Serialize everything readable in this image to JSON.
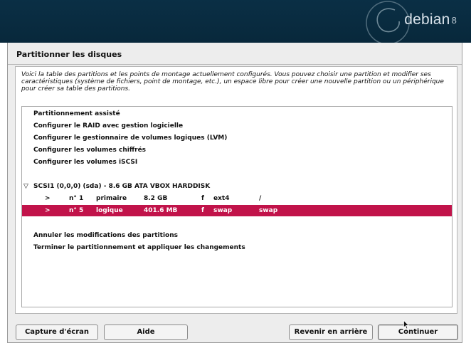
{
  "banner": {
    "brand": "debian",
    "version": "8"
  },
  "page": {
    "title": "Partitionner les disques",
    "intro": "Voici la table des partitions et les points de montage actuellement configurés. Vous pouvez choisir une partition et modifier ses caractéristiques (système de fichiers, point de montage, etc.), un espace libre pour créer une nouvelle partition ou un périphérique pour créer sa table des partitions."
  },
  "menu": {
    "items": [
      "Partitionnement assisté",
      "Configurer le RAID avec gestion logicielle",
      "Configurer le gestionnaire de volumes logiques (LVM)",
      "Configurer les volumes chiffrés",
      "Configurer les volumes iSCSI"
    ],
    "disk": {
      "toggle": "▽",
      "label": "SCSI1 (0,0,0) (sda) - 8.6 GB ATA VBOX HARDDISK"
    },
    "partitions": [
      {
        "arrow": ">",
        "num": "n° 1",
        "type": "primaire",
        "size": "8.2 GB",
        "flag": "f",
        "fs": "ext4",
        "mount": "/"
      },
      {
        "arrow": ">",
        "num": "n° 5",
        "type": "logique",
        "size": "401.6 MB",
        "flag": "f",
        "fs": "swap",
        "mount": "swap"
      }
    ],
    "actions": [
      "Annuler les modifications des partitions",
      "Terminer le partitionnement et appliquer les changements"
    ]
  },
  "buttons": {
    "screenshot": "Capture d'écran",
    "help": "Aide",
    "back": "Revenir en arrière",
    "continue": "Continuer"
  },
  "colors": {
    "selection": "#c1134a",
    "banner": "#0a2f45"
  }
}
